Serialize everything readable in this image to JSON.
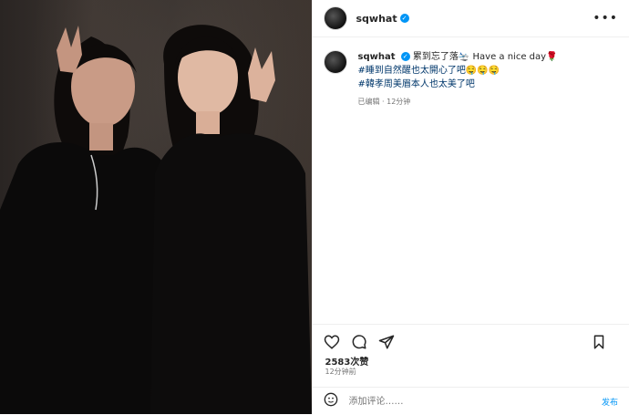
{
  "post": {
    "username": "sqwhat",
    "caption_text": "累到忘了落🛬 Have a nice day🌹",
    "hashtag1": "#睡到自然醒也太開心了吧🤤🤤🤤",
    "hashtag2": "#韓孝周美眉本人也太美了吧",
    "edited_time": "已编辑 · 12分钟",
    "likes": "2583次赞",
    "posted": "12分钟前"
  },
  "comment": {
    "placeholder": "添加评论……",
    "post_label": "发布"
  },
  "icons": {
    "header_more": "more-icon",
    "like": "heart-icon",
    "comment": "comment-icon",
    "share": "share-icon",
    "save": "bookmark-icon",
    "emoji": "emoji-icon",
    "verified": "verified-badge-icon"
  },
  "colors": {
    "accent": "#0095f6",
    "hashtag": "#00376b"
  }
}
